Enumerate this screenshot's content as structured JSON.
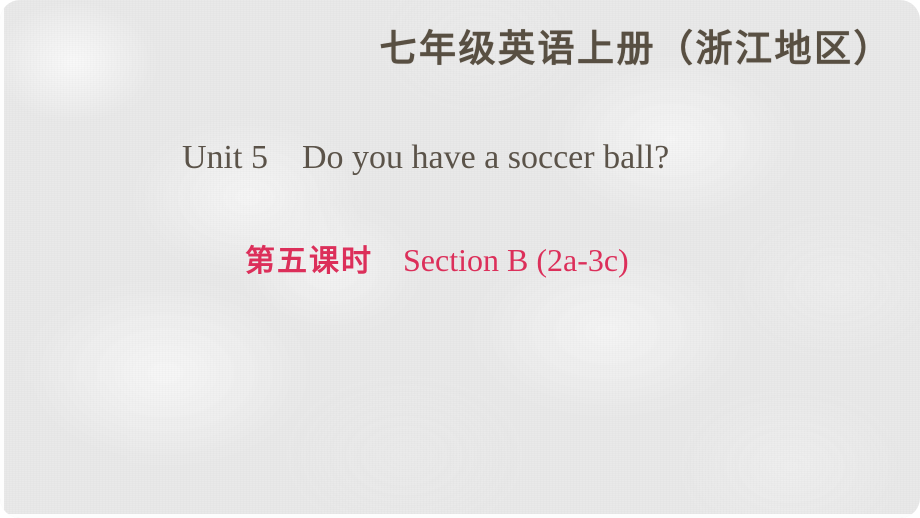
{
  "slide": {
    "header": {
      "text": "七年级英语上册（浙江地区）",
      "color": "#584F42"
    },
    "title": {
      "text": "Unit 5　Do you have a soccer ball?",
      "unit_label": "Unit 5",
      "lesson_question": "Do you have a soccer ball?",
      "color": "#5B5349"
    },
    "subtitle": {
      "period_cn": "第五课时",
      "section_en": "Section B (2a-3c)",
      "color": "#DC2F5A"
    },
    "background": {
      "color": "#E9E9E9",
      "edge_color": "#FDFDFD"
    }
  }
}
